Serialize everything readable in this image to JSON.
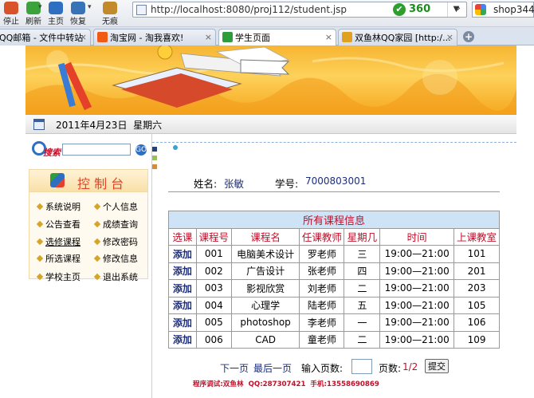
{
  "browser": {
    "toolbar": [
      {
        "label": "停止",
        "color": "#d9532a"
      },
      {
        "label": "刷新",
        "color": "#3aa33a"
      },
      {
        "label": "主页",
        "color": "#2f6fc2"
      },
      {
        "label": "恢复",
        "color": "#3873b8"
      },
      {
        "label": "无痕",
        "color": "#c28a2a"
      }
    ],
    "address": "http://localhost:8080/proj112/student.jsp",
    "address_brand": "360",
    "search_engine": "shop344",
    "tabs": [
      {
        "label": "QQ邮箱 - 文件中转站",
        "color": "#2d8de0"
      },
      {
        "label": "淘宝网 - 淘我喜欢!",
        "color": "#f05a14"
      },
      {
        "label": "学生页面",
        "color": "#2f9d3c"
      },
      {
        "label": "双鱼林QQ家园 [http:/...",
        "color": "#e0a020"
      }
    ]
  },
  "date": "2011年4月23日  星期六",
  "sidebar": {
    "search_label": "搜索",
    "search_value": "",
    "console_title": "控 制 台",
    "menu": [
      [
        "系统说明",
        "个人信息"
      ],
      [
        "公告查看",
        "成绩查询"
      ],
      [
        "选修课程",
        "修改密码"
      ],
      [
        "所选课程",
        "修改信息"
      ],
      [
        "学校主页",
        "退出系统"
      ]
    ]
  },
  "student": {
    "name_label": "姓名:",
    "name": "张敏",
    "id_label": "学号:",
    "id": "7000803001"
  },
  "table": {
    "caption": "所有课程信息",
    "headers": [
      "选课",
      "课程号",
      "课程名",
      "任课教师",
      "星期几",
      "时间",
      "上课教室"
    ],
    "rows": [
      [
        "添加",
        "001",
        "电脑美术设计",
        "罗老师",
        "三",
        "19:00—21:00",
        "101"
      ],
      [
        "添加",
        "002",
        "广告设计",
        "张老师",
        "四",
        "19:00—21:00",
        "201"
      ],
      [
        "添加",
        "003",
        "影视欣赏",
        "刘老师",
        "二",
        "19:00—21:00",
        "203"
      ],
      [
        "添加",
        "004",
        "心理学",
        "陆老师",
        "五",
        "19:00—21:00",
        "105"
      ],
      [
        "添加",
        "005",
        "photoshop",
        "李老师",
        "一",
        "19:00—21:00",
        "106"
      ],
      [
        "添加",
        "006",
        "CAD",
        "童老师",
        "二",
        "19:00—21:00",
        "109"
      ]
    ]
  },
  "pager": {
    "next": "下一页",
    "last": "最后一页",
    "input_label": "输入页数:",
    "page_value": "",
    "pages_label": "页数:",
    "pages": "1/2",
    "submit": "提交"
  },
  "footer": "程序调试:双鱼林  QQ:287307421  手机:13558690869",
  "colors": {
    "link": "#1c2e7e",
    "accent_red": "#c0102a",
    "table_header": "#cfe3f7",
    "banner": "#f7b531"
  }
}
